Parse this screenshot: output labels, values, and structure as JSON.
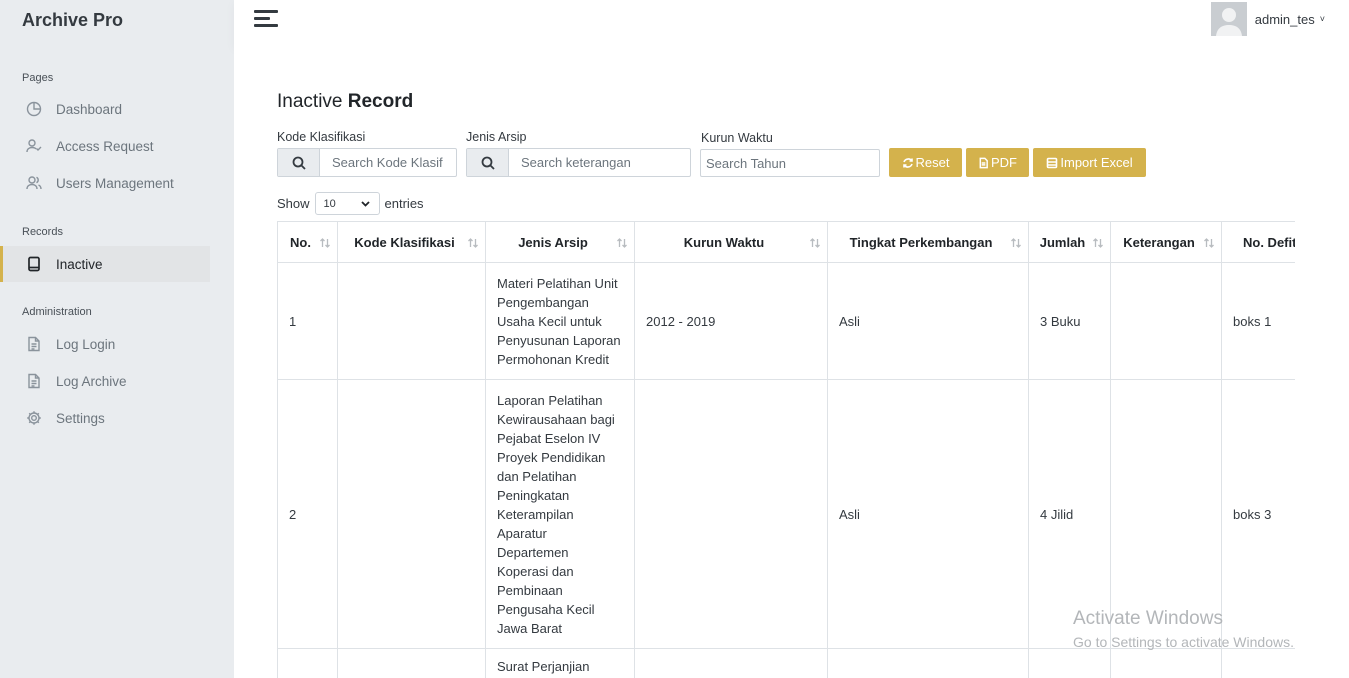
{
  "app": {
    "brand": "Archive Pro"
  },
  "sidebar": {
    "sections": [
      {
        "header": "Pages"
      },
      {
        "header": "Records"
      },
      {
        "header": "Administration"
      }
    ],
    "items": [
      {
        "label": "Dashboard",
        "icon": "pie-chart-icon"
      },
      {
        "label": "Access Request",
        "icon": "user-check-icon"
      },
      {
        "label": "Users Management",
        "icon": "users-icon"
      },
      {
        "label": "Inactive",
        "icon": "tablet-icon",
        "active": true
      },
      {
        "label": "Log Login",
        "icon": "file-text-icon"
      },
      {
        "label": "Log Archive",
        "icon": "file-text-icon"
      },
      {
        "label": "Settings",
        "icon": "gear-icon"
      }
    ]
  },
  "topbar": {
    "username": "admin_tes",
    "chevron": "˅"
  },
  "page": {
    "title_prefix": "Inactive",
    "title_bold": "Record"
  },
  "filters": {
    "kode_label": "Kode Klasifikasi",
    "kode_placeholder": "Search Kode Klasif",
    "jenis_label": "Jenis Arsip",
    "jenis_placeholder": "Search keterangan",
    "kurun_label": "Kurun Waktu",
    "kurun_placeholder": "Search Tahun"
  },
  "buttons": {
    "reset": "Reset",
    "pdf": "PDF",
    "import": "Import Excel"
  },
  "length": {
    "show": "Show",
    "value": "10",
    "entries": "entries"
  },
  "table": {
    "columns": [
      "No.",
      "Kode Klasifikasi",
      "Jenis Arsip",
      "Kurun Waktu",
      "Tingkat Perkembangan",
      "Jumlah",
      "Keterangan",
      "No. Defit"
    ],
    "rows": [
      {
        "no": "1",
        "kode": "",
        "jenis": [
          "Materi Pelatihan Unit",
          "Pengembangan",
          "Usaha Kecil untuk",
          "Penyusunan Laporan",
          "Permohonan Kredit"
        ],
        "kurun": "2012 - 2019",
        "tingkat": "Asli",
        "jumlah": "3 Buku",
        "keterangan": "",
        "defit": "boks 1"
      },
      {
        "no": "2",
        "kode": "",
        "jenis": [
          "Laporan Pelatihan",
          "Kewirausahaan bagi",
          "Pejabat Eselon IV",
          "Proyek Pendidikan",
          "dan Pelatihan",
          "Peningkatan",
          "Keterampilan",
          "Aparatur",
          "Departemen",
          "Koperasi dan",
          "Pembinaan",
          "Pengusaha Kecil",
          "Jawa Barat"
        ],
        "kurun": "",
        "tingkat": "Asli",
        "jumlah": "4 Jilid",
        "keterangan": "",
        "defit": "boks 3"
      },
      {
        "no": "",
        "kode": "",
        "jenis": [
          "Surat Perjanjian"
        ],
        "kurun": "",
        "tingkat": "",
        "jumlah": "",
        "keterangan": "",
        "defit": ""
      }
    ]
  },
  "watermark": {
    "line1": "Activate Windows",
    "line2": "Go to Settings to activate Windows."
  }
}
